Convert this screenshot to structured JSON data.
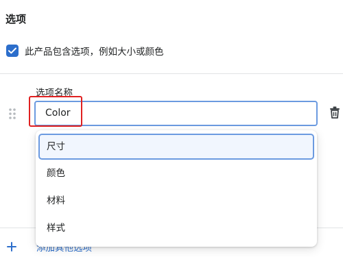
{
  "section": {
    "title": "选项"
  },
  "has_options": {
    "checked": true,
    "label": "此产品包含选项，例如大小或颜色"
  },
  "option": {
    "name_label": "选项名称",
    "name_value": "Color"
  },
  "suggestions": {
    "items": [
      {
        "label": "尺寸",
        "highlighted": true
      },
      {
        "label": "颜色",
        "highlighted": false
      },
      {
        "label": "材料",
        "highlighted": false
      },
      {
        "label": "样式",
        "highlighted": false
      }
    ]
  },
  "add_option": {
    "label": "添加其他选项"
  },
  "colors": {
    "accent": "#2c6ecb",
    "focus_border": "#6b9ae0",
    "highlight_annotation": "#e02020"
  },
  "icons": {
    "drag": "drag-handle-icon",
    "delete": "trash-icon",
    "add": "plus-icon",
    "check": "checkmark-icon"
  }
}
